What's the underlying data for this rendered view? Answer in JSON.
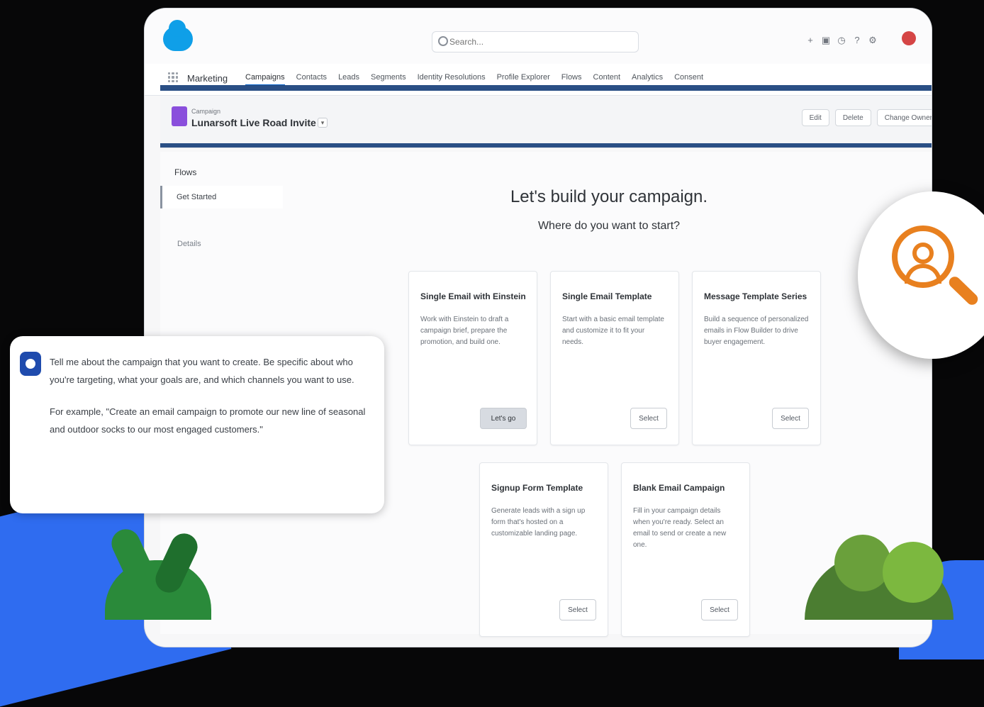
{
  "search": {
    "placeholder": "Search..."
  },
  "header_util": [
    "+",
    "▣",
    "◷",
    "?",
    "⚙"
  ],
  "nav": {
    "app_name": "Marketing",
    "items": [
      {
        "label": "Campaigns",
        "active": true
      },
      {
        "label": "Contacts"
      },
      {
        "label": "Leads"
      },
      {
        "label": "Segments"
      },
      {
        "label": "Identity Resolutions"
      },
      {
        "label": "Profile Explorer"
      },
      {
        "label": "Flows"
      },
      {
        "label": "Content"
      },
      {
        "label": "Analytics"
      },
      {
        "label": "Consent"
      }
    ]
  },
  "record": {
    "label": "Campaign",
    "title": "Lunarsoft Live Road Invite",
    "actions": [
      "Edit",
      "Delete",
      "Change Owner"
    ]
  },
  "sidebar": {
    "title": "Flows",
    "active_item": "Get Started",
    "details": "Details"
  },
  "main": {
    "heading": "Let's build your campaign.",
    "subheading": "Where do you want to start?"
  },
  "cards": [
    {
      "title": "Single Email with Einstein",
      "desc": "Work with Einstein to draft a campaign brief, prepare the promotion, and build one.",
      "button": "Let's go"
    },
    {
      "title": "Single Email Template",
      "desc": "Start with a basic email template and customize it to fit your needs.",
      "button": "Select"
    },
    {
      "title": "Message Template Series",
      "desc": "Build a sequence of personalized emails in Flow Builder to drive buyer engagement.",
      "button": "Select"
    },
    {
      "title": "Signup Form Template",
      "desc": "Generate leads with a sign up form that's hosted on a customizable landing page.",
      "button": "Select"
    },
    {
      "title": "Blank Email Campaign",
      "desc": "Fill in your campaign details when you're ready. Select an email to send or create a new one.",
      "button": "Select"
    }
  ],
  "chat": {
    "p1": "Tell me about the campaign that you want to create. Be specific about who you're targeting, what your goals are, and which channels you want to use.",
    "p2": "For example, \"Create an email campaign to promote our new line of seasonal and outdoor socks to our most engaged customers.\""
  }
}
